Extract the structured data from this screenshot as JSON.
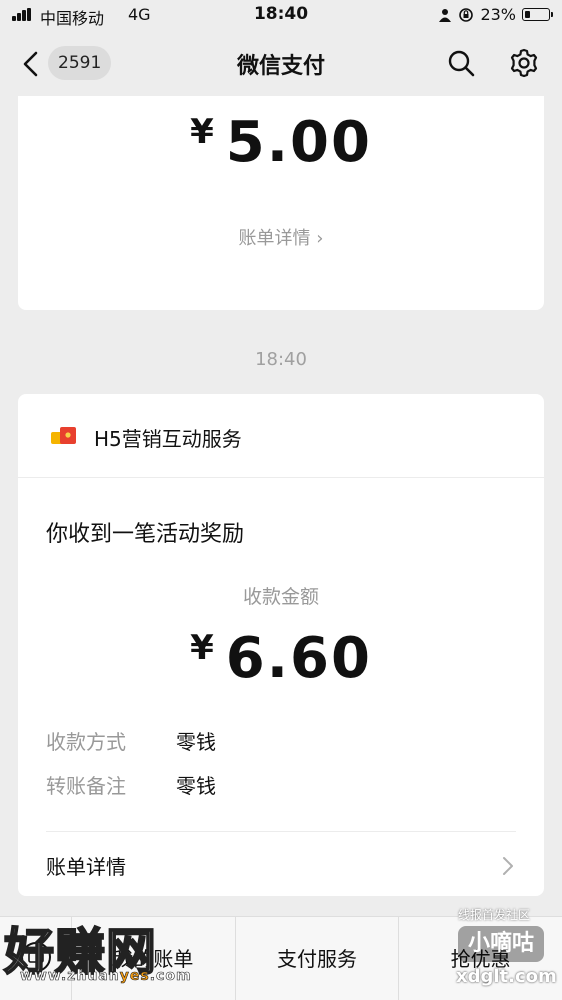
{
  "status_bar": {
    "carrier": "中国移动",
    "network": "4G",
    "time": "18:40",
    "battery": "23%",
    "battery_level": 0.23
  },
  "nav": {
    "unread_count": "2591",
    "title": "微信支付",
    "icons": [
      "chevron-left-icon",
      "search-icon",
      "gear-icon"
    ]
  },
  "card_previous": {
    "currency": "¥",
    "amount": "5.00",
    "detail_link": "账单详情 ›"
  },
  "time_separator": "18:40",
  "card_reward": {
    "service_name": "H5营销互动服务",
    "message": "你收到一笔活动奖励",
    "amount_label": "收款金额",
    "currency": "¥",
    "amount": "6.60",
    "rows": [
      {
        "key": "收款方式",
        "value": "零钱"
      },
      {
        "key": "转账备注",
        "value": "零钱"
      }
    ],
    "bill_detail": "账单详情"
  },
  "bottom_menu": {
    "items": [
      "我的账单",
      "支付服务",
      "抢优惠"
    ]
  },
  "watermarks": {
    "left_brand": "好赚网",
    "left_url_a": "www.zhuan",
    "left_url_b": "yes",
    "left_url_c": ".com",
    "right_top": "线报首发社区",
    "right_brand": "小嘀咕",
    "right_url": "xdglt.com"
  },
  "colors": {
    "background": "#ededed",
    "card": "#ffffff",
    "muted_text": "#999999"
  }
}
